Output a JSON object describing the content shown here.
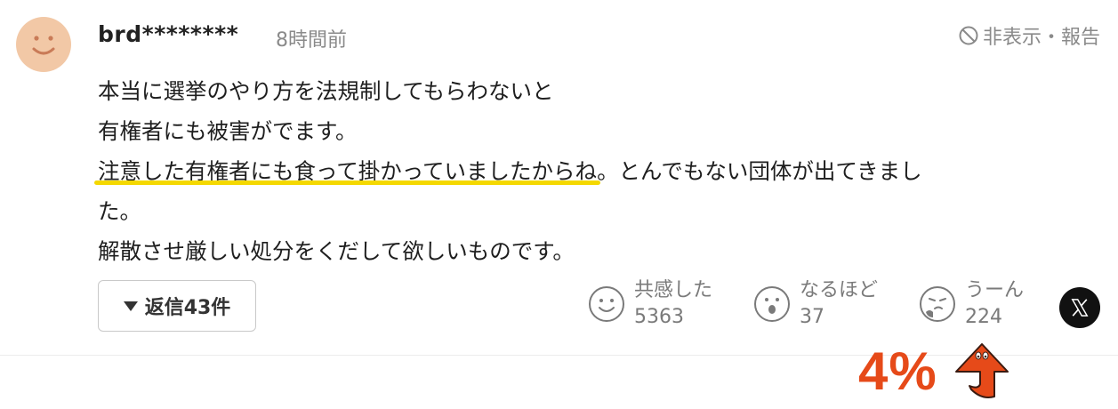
{
  "comment": {
    "username": "brd********",
    "time": "8時間前",
    "hide_report": "非表示・報告",
    "lines": [
      "本当に選挙のやり方を法規制してもらわないと",
      "有権者にも被害がでます。"
    ],
    "highlighted": "注意した有権者にも食って掛かっていましたからね",
    "after_highlight": "。とんでもない団体が出てきまし",
    "wrap": "た。",
    "last_line": "解散させ厳しい処分をくだして欲しいものです。"
  },
  "reply": {
    "label": "返信43件"
  },
  "reactions": [
    {
      "label": "共感した",
      "count": "5363",
      "icon": "smile-face-icon"
    },
    {
      "label": "なるほど",
      "count": "37",
      "icon": "surprised-face-icon"
    },
    {
      "label": "うーん",
      "count": "224",
      "icon": "thinking-face-icon"
    }
  ],
  "share": {
    "icon": "x-logo-icon"
  },
  "annotation": {
    "percent": "4%",
    "color": "#e64a19"
  }
}
